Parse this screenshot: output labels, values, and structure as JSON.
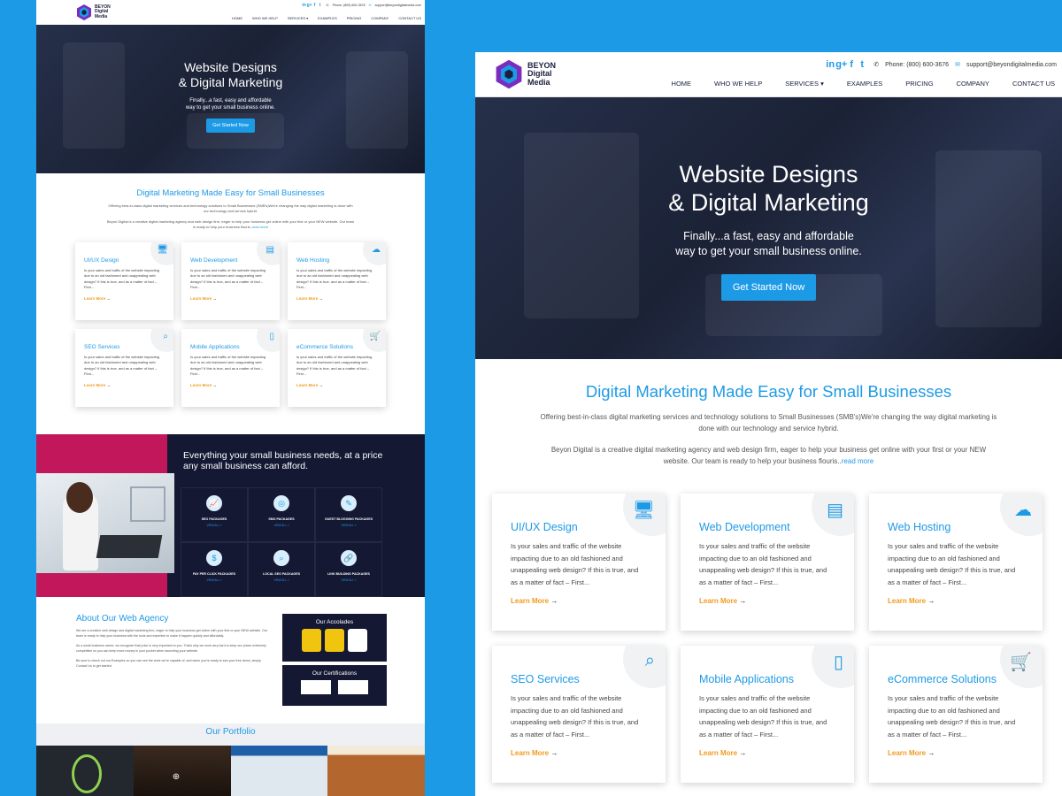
{
  "site": {
    "logo_text": [
      "BEYON",
      "Digital",
      "Media"
    ],
    "phone": "Phone: (800) 600-3676",
    "email": "support@beyondigitalmedia.com",
    "social_icons": [
      "linkedin-icon",
      "google-plus-icon",
      "facebook-icon",
      "twitter-icon"
    ],
    "nav": [
      "HOME",
      "WHO WE HELP",
      "SERVICES",
      "EXAMPLES",
      "PRICING",
      "COMPANY",
      "CONTACT US"
    ],
    "hero": {
      "title_line1": "Website Designs",
      "title_line2": "& Digital Marketing",
      "sub_line1": "Finally...a fast, easy and affordable",
      "sub_line2": "way to get your small business online.",
      "cta": "Get Started Now"
    },
    "intro": {
      "heading": "Digital Marketing Made Easy for Small Businesses",
      "p1": "Offering best-in-class digital marketing services and technology solutions to Small Businesses (SMB's)We're changing the way digital marketing is done with our technology and service hybrid.",
      "p2": "Beyon Digital is a creative digital marketing agency and web design firm, eager to help your business get online with your first or your NEW website. Our team is ready to help your business flouris..",
      "read_more": "read more"
    },
    "card_body": "Is your sales and traffic of the website impacting due to an old fashioned and unappealing web design? If this is true, and as a matter of fact – First...",
    "learn_more": "Learn More",
    "cards": [
      {
        "title": "UI/UX Design",
        "icon": "design-monitor-icon"
      },
      {
        "title": "Web Development",
        "icon": "web-development-icon"
      },
      {
        "title": "Web Hosting",
        "icon": "cloud-hosting-icon"
      },
      {
        "title": "SEO Services",
        "icon": "seo-search-icon"
      },
      {
        "title": "Mobile Applications",
        "icon": "mobile-app-icon"
      },
      {
        "title": "eCommerce Solutions",
        "icon": "shopping-cart-icon"
      }
    ],
    "band": {
      "heading": "Everything your small business needs, at a price any small business can afford.",
      "services": [
        "SEO PACKAGES",
        "SMO PACKAGES",
        "GUEST BLOGGING PACKAGES",
        "PAY PER CLICK PACKAGES",
        "LOCAL SEO PACKAGES",
        "LINK BUILDING PACKAGES"
      ],
      "view_all": "VIEW ALL »"
    },
    "about": {
      "heading": "About Our Web Agency",
      "p1": "We are a creative web design and digital marketing firm, eager to help your business get online with your first or your NEW website. Our team is ready to help your business with the tools and expertise to make it happen quickly and affordably.",
      "p2": "As a small business owner, we recognize that price is very important to you. That's why we work very hard to keep our prices extremely competitive so you can keep more money in your pocket when launching your website.",
      "p3": "Be sure to check out our Examples so you can see the work we're capable of, and when you're ready to see your free demo, simply Contact Us to get started.",
      "accolades": "Our Accolades",
      "certifications": "Our Certifications"
    },
    "portfolio": {
      "heading": "Our Portfolio"
    }
  }
}
